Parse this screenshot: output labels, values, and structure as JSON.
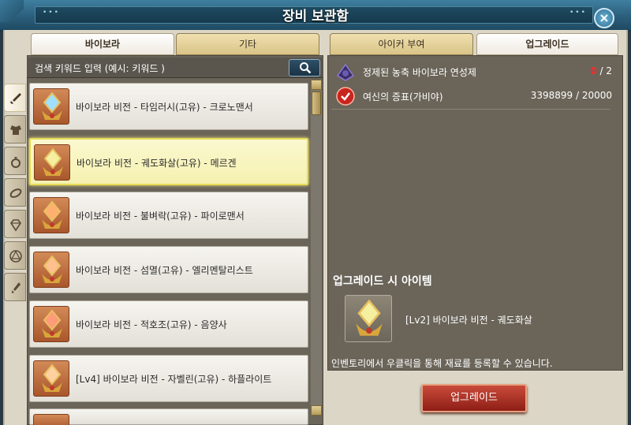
{
  "window": {
    "title": "장비 보관함",
    "close_glyph": "×"
  },
  "left_tabs": [
    {
      "label": "바이보라",
      "active": true
    },
    {
      "label": "기타",
      "active": false
    }
  ],
  "right_tabs": [
    {
      "label": "아이커 부여",
      "active": false
    },
    {
      "label": "업그레이드",
      "active": true
    }
  ],
  "search": {
    "placeholder": "검색 키워드 입력 (예시: 키워드 )",
    "icon": "search-icon"
  },
  "side_categories": [
    {
      "icon": "sword-icon",
      "active": true
    },
    {
      "icon": "armor-icon",
      "active": false
    },
    {
      "icon": "ring-icon",
      "active": false
    },
    {
      "icon": "bracelet-icon",
      "active": false
    },
    {
      "icon": "gem-icon",
      "active": false
    },
    {
      "icon": "crystal-icon",
      "active": false
    },
    {
      "icon": "blade-icon",
      "active": false
    }
  ],
  "items": [
    {
      "label": "바이보라 비전 - 타임러시(고유) - 크로노맨서",
      "selected": false
    },
    {
      "label": "바이보라 비전 - 궤도화살(고유) - 메르겐",
      "selected": true
    },
    {
      "label": "바이보라 비전 - 불벼락(고유) - 파이로맨서",
      "selected": false
    },
    {
      "label": "바이보라 비전 - 섬멸(고유) - 엘리멘탈리스트",
      "selected": false
    },
    {
      "label": "바이보라 비전 - 적호조(고유) - 음양사",
      "selected": false
    },
    {
      "label": "[Lv4] 바이보라 비전 - 자벨린(고유) - 하플라이트",
      "selected": false
    }
  ],
  "materials": [
    {
      "name": "정제된 농축 바이보라 연성제",
      "have": "0",
      "need": "2",
      "icon": "purified-concentrate-icon"
    },
    {
      "name": "여신의 증표(가비야)",
      "have": "3398899",
      "need": "20000",
      "icon": "goddess-token-icon"
    }
  ],
  "result": {
    "title": "업그레이드 시 아이템",
    "name": "[Lv2] 바이보라 비전 - 궤도화살"
  },
  "hint": "인벤토리에서 우클릭을 통해 재료를 등록할 수 있습니다.",
  "upgrade_button": "업그레이드",
  "colors": {
    "title_bar": "#2b5f7c",
    "selected_border": "#e6db55",
    "upgrade_button": "#b03a2c",
    "missing_count": "#ff2a2a"
  }
}
